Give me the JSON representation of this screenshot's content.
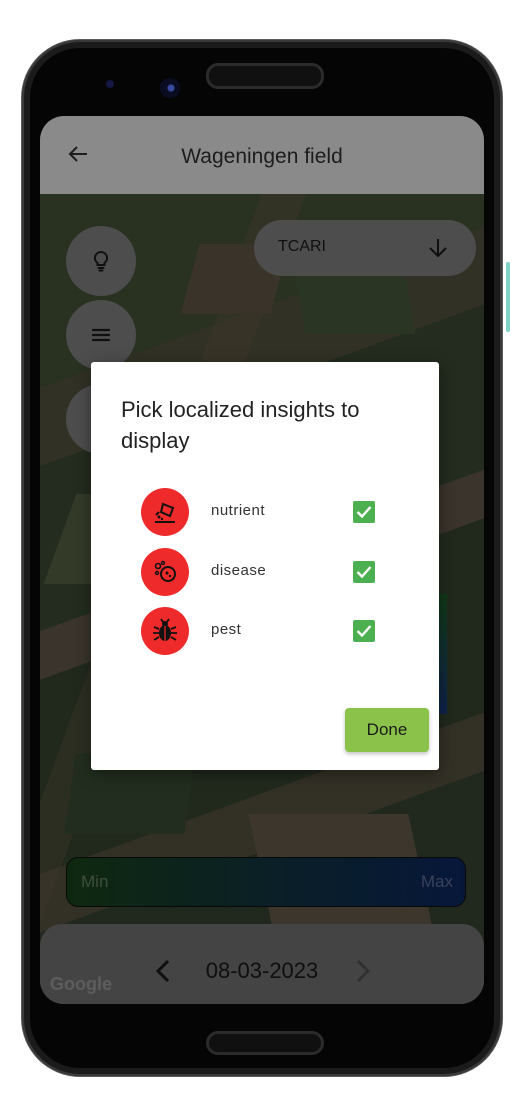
{
  "app": {
    "title": "Wageningen field"
  },
  "layer_select": {
    "selected": "TCARI"
  },
  "legend": {
    "min_label": "Min",
    "max_label": "Max",
    "colors": [
      "#1b4a1d",
      "#0d2b6a"
    ]
  },
  "date_nav": {
    "date": "08-03-2023"
  },
  "map_attribution": "Google",
  "dialog": {
    "title": "Pick localized insights to display",
    "options": [
      {
        "label": "nutrient",
        "icon": "nutrient-icon",
        "checked": true
      },
      {
        "label": "disease",
        "icon": "disease-icon",
        "checked": true
      },
      {
        "label": "pest",
        "icon": "pest-icon",
        "checked": true
      }
    ],
    "done_label": "Done",
    "accent_color": "#ef2a2a",
    "check_color": "#4caf50",
    "button_color": "#8bc34a"
  }
}
